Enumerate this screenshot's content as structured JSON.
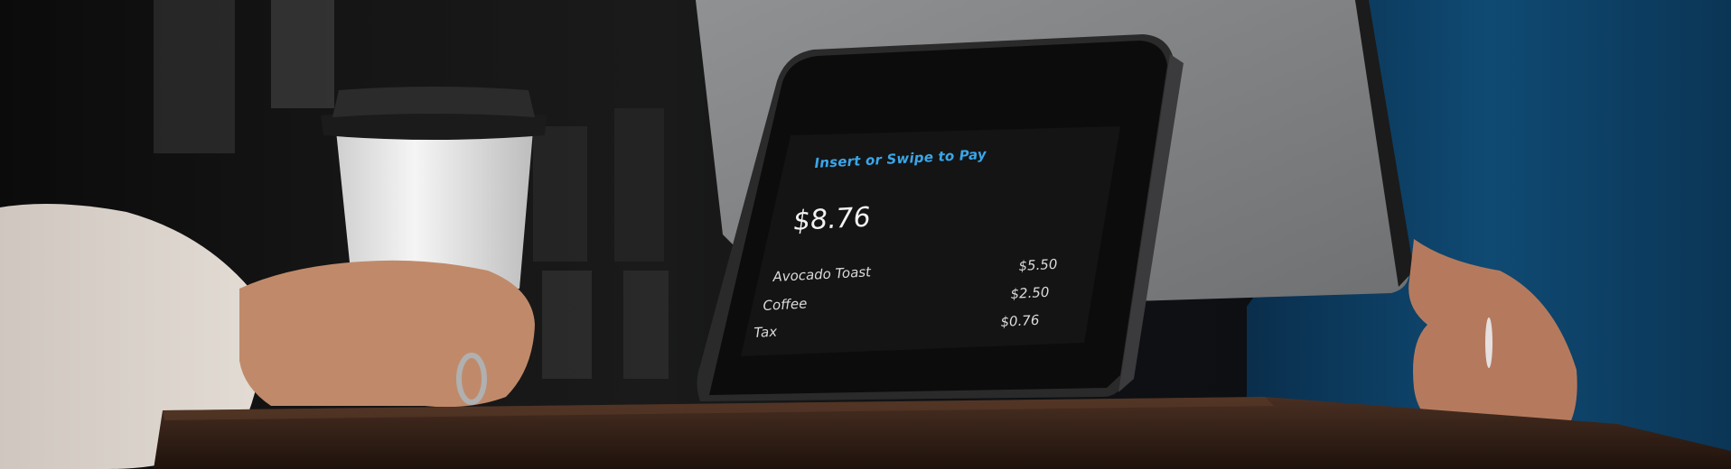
{
  "terminal": {
    "prompt": "Insert or Swipe to Pay",
    "total": "$8.76",
    "line_items": [
      {
        "label": "Avocado Toast",
        "price": "$5.50"
      },
      {
        "label": "Coffee",
        "price": "$2.50"
      },
      {
        "label": "Tax",
        "price": "$0.76"
      }
    ]
  },
  "colors": {
    "prompt_text": "#3aa6e8",
    "screen_bg": "#141414",
    "shirt_blue": "#0f4a73",
    "tablet_back": "#9a9c9e",
    "table_wood": "#3a2418"
  }
}
